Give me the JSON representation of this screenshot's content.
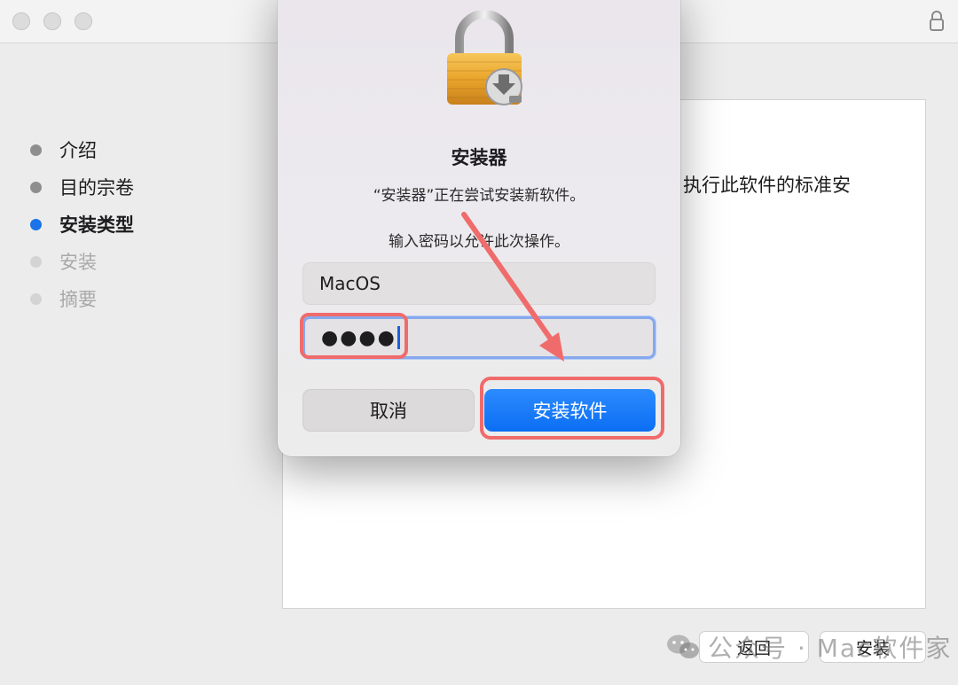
{
  "window": {
    "traffic_lights": [
      "close",
      "minimize",
      "zoom"
    ]
  },
  "sidebar": {
    "steps": [
      {
        "label": "介绍",
        "state": "done"
      },
      {
        "label": "目的宗卷",
        "state": "done"
      },
      {
        "label": "安装类型",
        "state": "active"
      },
      {
        "label": "安装",
        "state": "pending"
      },
      {
        "label": "摘要",
        "state": "pending"
      }
    ]
  },
  "content": {
    "visible_text": "执行此软件的标准安"
  },
  "footer": {
    "back_label": "返回",
    "install_label": "安装"
  },
  "watermark": {
    "text": "公众号 · Mac软件家"
  },
  "dialog": {
    "title": "安装器",
    "message": "“安装器”正在尝试安装新软件。",
    "prompt": "输入密码以允许此次操作。",
    "username_value": "MacOS",
    "password_masked": "●●●●",
    "cancel_label": "取消",
    "install_software_label": "安装软件"
  },
  "colors": {
    "accent_blue": "#1a73e8",
    "annotation_red": "#f06b6b",
    "focus_ring": "#86a9ee"
  }
}
